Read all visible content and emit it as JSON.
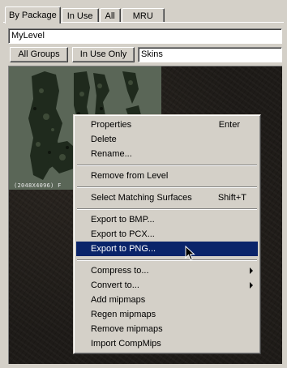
{
  "tabs": [
    {
      "label": "By Package",
      "active": true
    },
    {
      "label": "In Use",
      "active": false
    },
    {
      "label": "All",
      "active": false
    },
    {
      "label": "MRU",
      "active": false
    }
  ],
  "package_combo": {
    "value": "MyLevel"
  },
  "filter_buttons": {
    "all_groups": "All Groups",
    "in_use_only": "In Use Only"
  },
  "group_field": {
    "value": "Skins"
  },
  "texture": {
    "caption": "(2048X4096) F"
  },
  "context_menu": {
    "items": [
      {
        "label": "Properties",
        "shortcut": "Enter"
      },
      {
        "label": "Delete",
        "shortcut": ""
      },
      {
        "label": "Rename...",
        "shortcut": ""
      },
      {
        "label": "Remove from Level",
        "shortcut": ""
      },
      {
        "label": "Select Matching Surfaces",
        "shortcut": "Shift+T"
      },
      {
        "label": "Export to BMP...",
        "shortcut": ""
      },
      {
        "label": "Export to PCX...",
        "shortcut": ""
      },
      {
        "label": "Export to PNG...",
        "shortcut": "",
        "highlighted": true
      },
      {
        "label": "Compress to...",
        "shortcut": "",
        "submenu": true
      },
      {
        "label": "Convert to...",
        "shortcut": "",
        "submenu": true
      },
      {
        "label": "Add mipmaps",
        "shortcut": ""
      },
      {
        "label": "Regen mipmaps",
        "shortcut": ""
      },
      {
        "label": "Remove mipmaps",
        "shortcut": ""
      },
      {
        "label": "Import CompMips",
        "shortcut": ""
      }
    ]
  },
  "colors": {
    "face": "#d4d0c8",
    "highlight": "#0a246a",
    "browser_bg": "#1e1b18",
    "thumb_bg": "#5a6657"
  }
}
